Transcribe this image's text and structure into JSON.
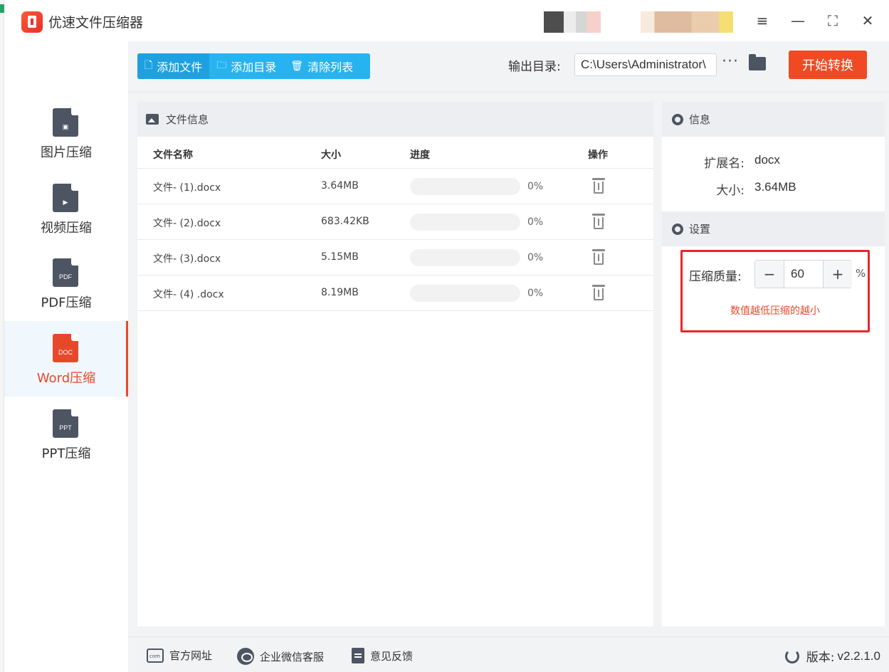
{
  "app": {
    "title": "优速文件压缩器"
  },
  "window_controls": [
    "menu-icon",
    "minimize-icon",
    "maximize-icon",
    "close-icon"
  ],
  "sidebar": {
    "items": [
      {
        "label": "图片压缩",
        "icon": "image-file-icon",
        "glyph": "▣",
        "active": false
      },
      {
        "label": "视频压缩",
        "icon": "video-file-icon",
        "glyph": "▶",
        "active": false
      },
      {
        "label": "PDF压缩",
        "icon": "pdf-file-icon",
        "glyph": "PDF",
        "active": false
      },
      {
        "label": "Word压缩",
        "icon": "doc-file-icon",
        "glyph": "DOC",
        "active": true
      },
      {
        "label": "PPT压缩",
        "icon": "ppt-file-icon",
        "glyph": "PPT",
        "active": false
      }
    ]
  },
  "toolbar": {
    "add_file": "添加文件",
    "add_dir": "添加目录",
    "clear_list": "清除列表",
    "output_label": "输出目录:",
    "output_path": "C:\\Users\\Administrator\\",
    "more": "···",
    "start": "开始转换"
  },
  "file_panel": {
    "title": "文件信息",
    "columns": {
      "name": "文件名称",
      "size": "大小",
      "progress": "进度",
      "action": "操作"
    },
    "rows": [
      {
        "name": "文件- (1).docx",
        "size": "3.64MB",
        "progress": 0,
        "progress_text": "0%"
      },
      {
        "name": "文件- (2).docx",
        "size": "683.42KB",
        "progress": 0,
        "progress_text": "0%"
      },
      {
        "name": "文件- (3).docx",
        "size": "5.15MB",
        "progress": 0,
        "progress_text": "0%"
      },
      {
        "name": "文件- (4) .docx",
        "size": "8.19MB",
        "progress": 0,
        "progress_text": "0%"
      }
    ]
  },
  "info_panel": {
    "title": "信息",
    "ext_label": "扩展名:",
    "ext_value": "docx",
    "size_label": "大小:",
    "size_value": "3.64MB"
  },
  "settings": {
    "title": "设置",
    "quality_label": "压缩质量:",
    "quality_value": "60",
    "minus": "−",
    "plus": "+",
    "unit": "%",
    "hint": "数值越低压缩的越小"
  },
  "footer": {
    "website": "官方网址",
    "wechat": "企业微信客服",
    "feedback": "意见反馈",
    "version_label": "版本:",
    "version": "v2.2.1.0"
  },
  "colors": {
    "accent": "#27b3f0",
    "primary_red": "#ef4a24",
    "highlight_box": "#e8262a"
  }
}
